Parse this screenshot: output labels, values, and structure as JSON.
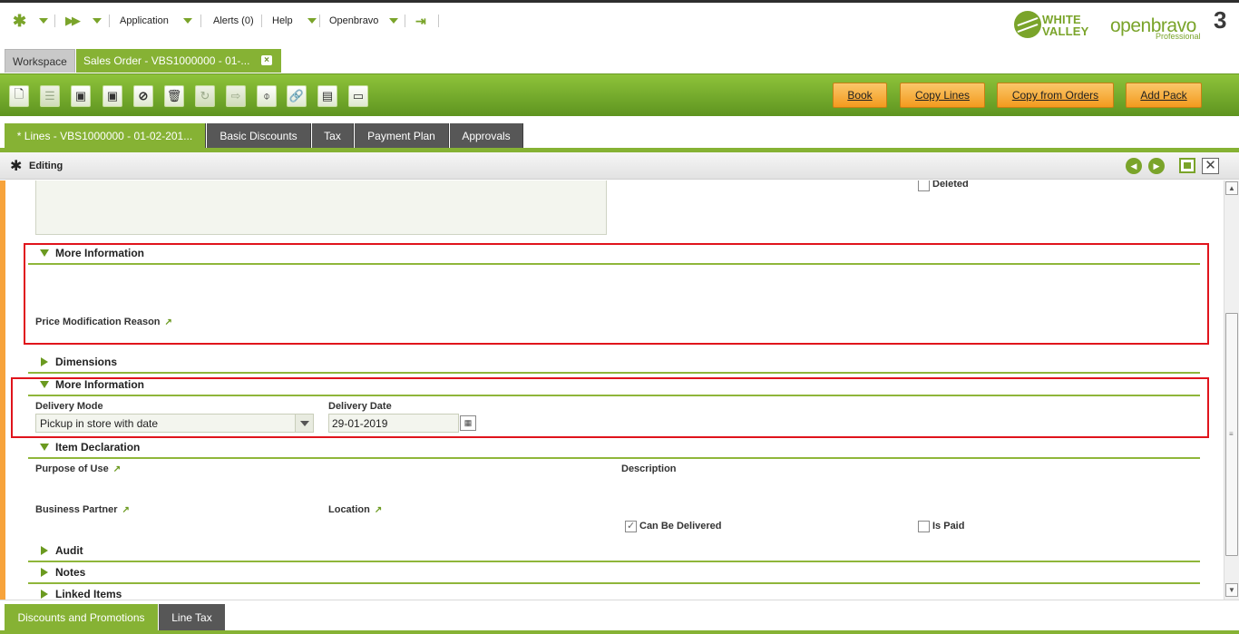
{
  "nav": {
    "application": "Application",
    "alerts": "Alerts (0)",
    "help": "Help",
    "user": "Openbravo"
  },
  "logos": {
    "white_valley_1": "WHITE",
    "white_valley_2": "VALLEY",
    "openbravo": "openbravo",
    "openbravo_version": "3",
    "edition": "Professional"
  },
  "window_tabs": {
    "workspace": "Workspace",
    "sales_order": "Sales Order - VBS1000000 - 01-..."
  },
  "toolbar": {
    "icons": [
      "new-document-icon",
      "grid-view-icon",
      "save-icon",
      "save-close-icon",
      "cancel-icon",
      "delete-icon",
      "refresh-icon",
      "export-icon",
      "attachment-icon",
      "link-icon",
      "print-icon",
      "toggle-view-icon"
    ],
    "book": "Book",
    "copy_lines": "Copy Lines",
    "copy_from_orders": "Copy from Orders",
    "add_pack": "Add Pack"
  },
  "child_tabs": [
    "* Lines - VBS1000000 - 01-02-201...",
    "Basic Discounts",
    "Tax",
    "Payment Plan",
    "Approvals"
  ],
  "editing": {
    "label": "Editing"
  },
  "form": {
    "deleted": "Deleted",
    "more_info_1": "More Information",
    "price_mod_reason": "Price Modification Reason",
    "dimensions": "Dimensions",
    "more_info_2": "More Information",
    "delivery_mode_label": "Delivery Mode",
    "delivery_mode_value": "Pickup in store with date",
    "delivery_date_label": "Delivery Date",
    "delivery_date_value": "29-01-2019",
    "item_declaration": "Item Declaration",
    "purpose_of_use": "Purpose of Use",
    "description": "Description",
    "business_partner": "Business Partner",
    "location": "Location",
    "can_be_delivered": "Can Be Delivered",
    "can_be_delivered_checked": true,
    "is_paid": "Is Paid",
    "is_paid_checked": false,
    "audit": "Audit",
    "notes": "Notes",
    "linked_items": "Linked Items"
  },
  "bottom_tabs": [
    "Discounts and Promotions",
    "Line Tax"
  ],
  "colors": {
    "brand_green": "#86b234",
    "action_orange": "#f39a1e",
    "highlight_red": "#e0141c",
    "left_accent": "#f7a33b"
  }
}
